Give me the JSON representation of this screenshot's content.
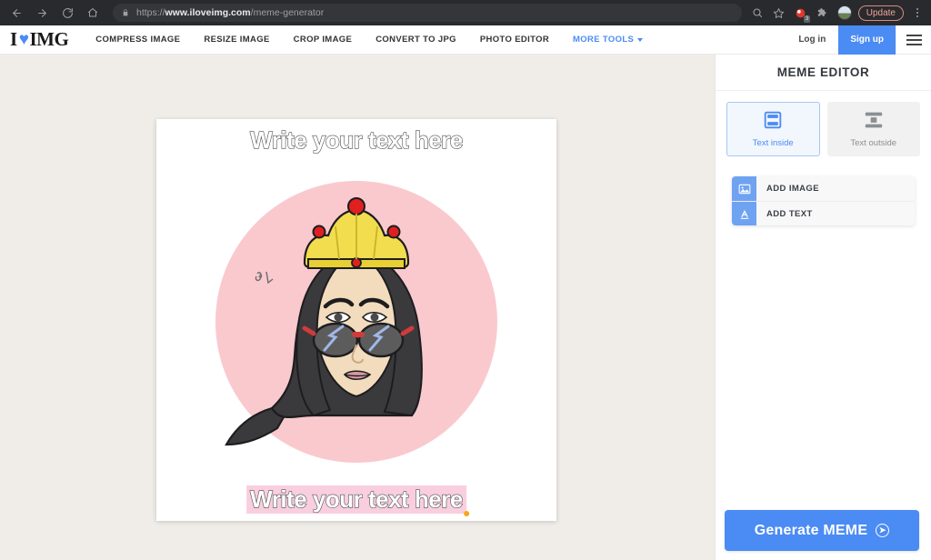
{
  "browser": {
    "back_icon": "back-arrow-icon",
    "forward_icon": "forward-arrow-icon",
    "reload_icon": "reload-icon",
    "home_icon": "home-icon",
    "lock_icon": "lock-icon",
    "url_scheme": "https://",
    "url_host": "www.iloveimg.com",
    "url_path": "/meme-generator",
    "search_icon": "search-icon",
    "bookmark_icon": "star-icon",
    "notification_icon": "notification-icon",
    "notification_badge": "3",
    "extensions_icon": "puzzle-piece-icon",
    "profile_icon": "profile-avatar-icon",
    "update_label": "Update",
    "menu_icon": "three-dot-menu-icon"
  },
  "site_header": {
    "logo_text_left": "I",
    "logo_heart": "♥",
    "logo_text_right": "IMG",
    "nav": [
      {
        "label": "COMPRESS IMAGE",
        "accent": false
      },
      {
        "label": "RESIZE IMAGE",
        "accent": false
      },
      {
        "label": "CROP IMAGE",
        "accent": false
      },
      {
        "label": "CONVERT TO JPG",
        "accent": false
      },
      {
        "label": "PHOTO EDITOR",
        "accent": false
      },
      {
        "label": "MORE TOOLS",
        "accent": true
      }
    ],
    "login_label": "Log in",
    "signup_label": "Sign up",
    "burger_icon": "hamburger-menu-icon"
  },
  "canvas": {
    "top_text": "Write your text here",
    "bottom_text": "Write your text here",
    "bottom_text_selected": true,
    "selection_color": "#f9cede",
    "handle_color": "#f4a818",
    "image_alt": "illustration-woman-hijab-crown-sunglasses"
  },
  "panel": {
    "title": "MEME EDITOR",
    "modes": [
      {
        "label": "Text inside",
        "icon": "text-inside-icon",
        "active": true
      },
      {
        "label": "Text outside",
        "icon": "text-outside-icon",
        "active": false
      }
    ],
    "actions": [
      {
        "label": "ADD IMAGE",
        "icon": "image-icon"
      },
      {
        "label": "ADD TEXT",
        "icon": "text-a-icon"
      }
    ],
    "generate_label": "Generate MEME",
    "generate_icon": "arrow-right-circle-icon"
  },
  "colors": {
    "accent": "#4b8bf4",
    "chrome_bg": "#292a2d",
    "workspace_bg": "#f0ede9",
    "update_pill": "#f0a59c"
  }
}
